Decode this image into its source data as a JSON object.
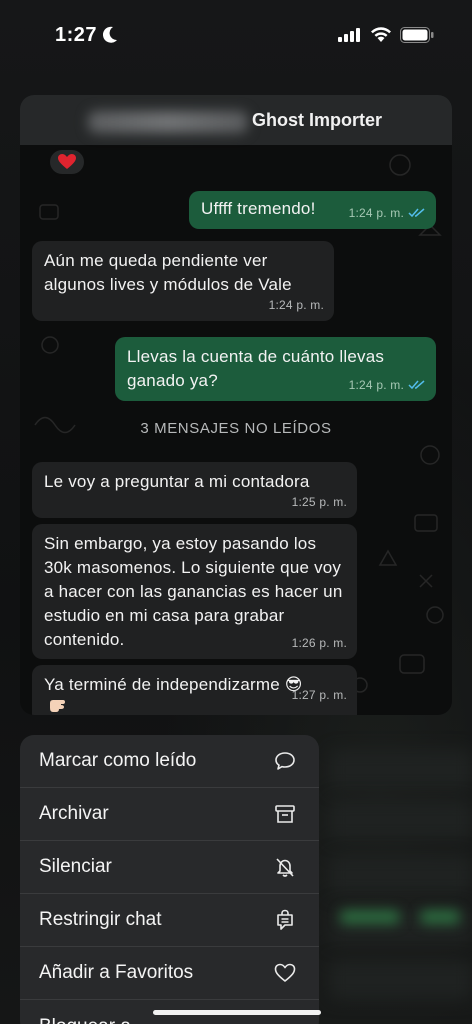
{
  "status_bar": {
    "time": "1:27"
  },
  "chat": {
    "title": "Ghost Importer",
    "unread_divider": "3 MENSAJES NO LEÍDOS",
    "messages": [
      {
        "text": "Uffff tremendo!",
        "time": "1:24 p. m."
      },
      {
        "text": "Aún me queda pendiente ver algunos lives y módulos de Vale",
        "time": "1:24 p. m."
      },
      {
        "text": "Llevas la cuenta de cuánto llevas ganado ya?",
        "time": "1:24 p. m."
      },
      {
        "text": "Le voy a preguntar a mi contadora",
        "time": "1:25 p. m."
      },
      {
        "text": "Sin embargo, ya estoy pasando los 30k masomenos. Lo siguiente que voy a hacer con las ganancias es hacer un estudio en mi casa para grabar contenido.",
        "time": "1:26 p. m."
      },
      {
        "text": "Ya terminé de independizarme 😎",
        "time": "1:27 p. m."
      }
    ]
  },
  "menu": {
    "items": [
      {
        "label": "Marcar como leído",
        "icon": "chat-bubble-icon"
      },
      {
        "label": "Archivar",
        "icon": "archive-icon"
      },
      {
        "label": "Silenciar",
        "icon": "bell-slash-icon"
      },
      {
        "label": "Restringir chat",
        "icon": "restricted-chat-icon"
      },
      {
        "label": "Añadir a Favoritos",
        "icon": "heart-icon"
      },
      {
        "label": "Bloquear a",
        "icon": ""
      }
    ]
  },
  "colors": {
    "outgoing_bubble": "#1c5c3c",
    "incoming_bubble": "#202122",
    "menu_bg": "#28292b",
    "read_ticks": "#53bdeb"
  }
}
